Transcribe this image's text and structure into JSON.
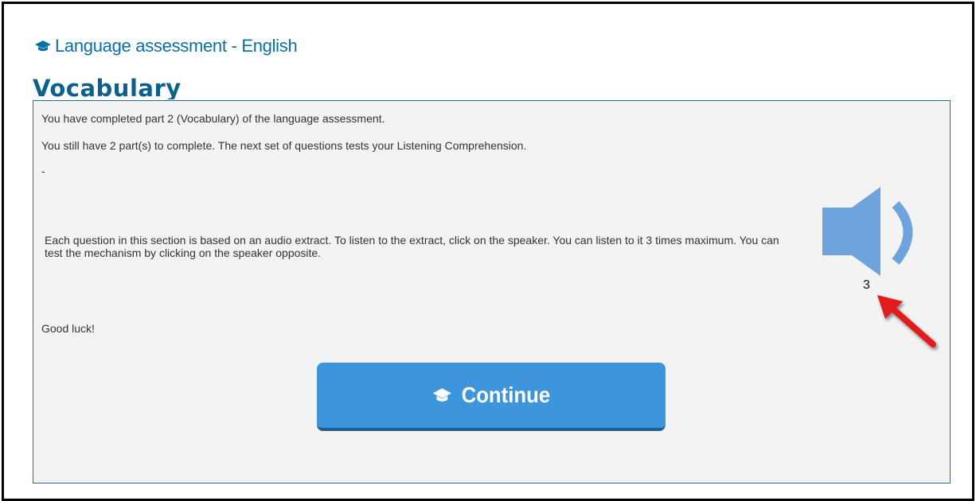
{
  "header": {
    "title": "Language assessment - English",
    "icon": "graduation-cap-icon"
  },
  "section": {
    "title": "Vocabulary"
  },
  "panel": {
    "completed_text": "You have completed part 2 (Vocabulary) of the language assessment.",
    "remaining_text": "You still have 2 part(s) to complete. The next set of questions tests your Listening Comprehension.",
    "separator": "-",
    "instructions": "Each question in this section is based on an audio extract. To listen to the extract, click on the speaker. You can listen to it 3 times maximum. You can test the mechanism by clicking on the speaker opposite.",
    "good_luck": "Good luck!"
  },
  "speaker": {
    "icon": "speaker-icon",
    "plays_remaining": "3"
  },
  "continue_button": {
    "label": "Continue",
    "icon": "graduation-cap-icon"
  },
  "colors": {
    "accent": "#0b6fa4",
    "button": "#3d96dc",
    "speaker": "#6fa3dd",
    "arrow": "#e01b1b"
  }
}
